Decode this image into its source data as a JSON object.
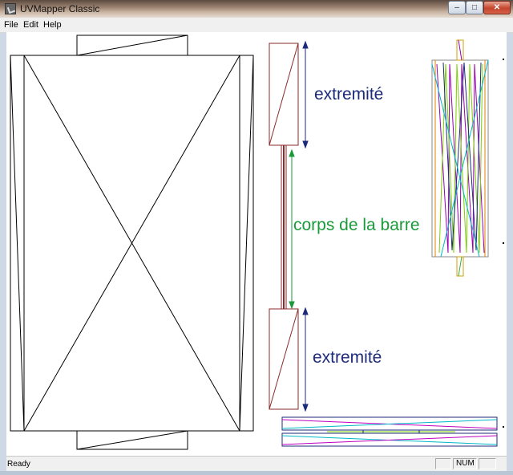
{
  "window": {
    "title": "UVMapper Classic",
    "buttons": {
      "minimize": "–",
      "maximize": "□",
      "close": "✕"
    }
  },
  "menu": [
    "File",
    "Edit",
    "Help"
  ],
  "labels": {
    "top": "extremité",
    "middle": "corps de la barre",
    "bottom": "extremité"
  },
  "status": {
    "text": "Ready",
    "num": "NUM"
  },
  "colors": {
    "label_blue": "#1c2a7a",
    "label_green": "#1a9a3a",
    "uv_outline": "#8b2a2a",
    "arrow_blue": "#1c2a7a",
    "arrow_green": "#1a9a3a"
  }
}
